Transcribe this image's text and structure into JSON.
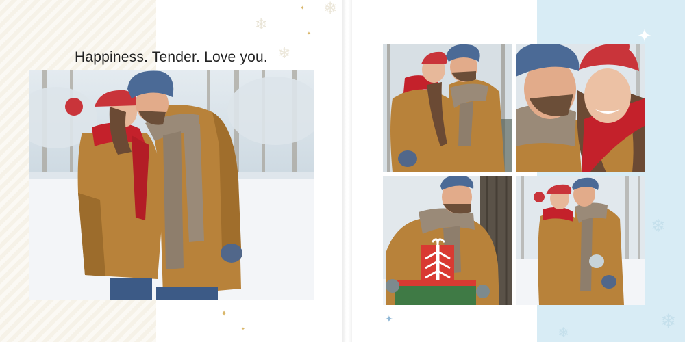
{
  "left_page": {
    "title": "Happiness. Tender. Love you."
  },
  "colors": {
    "coat": "#b8823a",
    "coat_dark": "#8f6125",
    "scarf_red": "#c4212b",
    "hat_red": "#c9343a",
    "hat_blue": "#4b6a96",
    "scarf_knit": "#9a8a78",
    "skin": "#e7b89a",
    "snow": "#f3f5f8",
    "sky_panel": "#d8ecf5",
    "gift_red": "#d93a32",
    "gift_green": "#3f7a45"
  },
  "icons": [
    "snowflake-icon",
    "star-icon"
  ]
}
